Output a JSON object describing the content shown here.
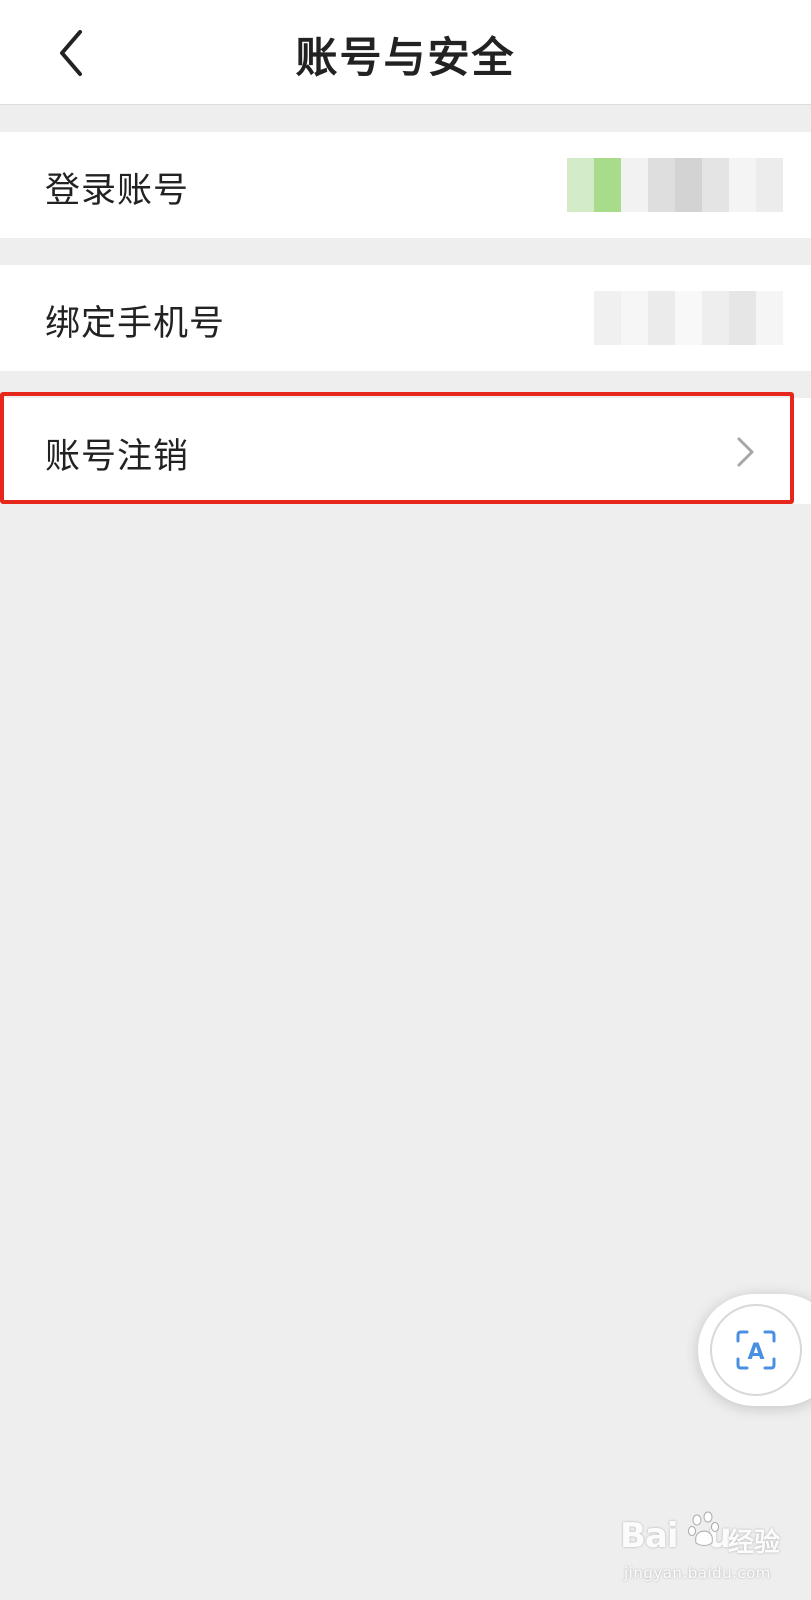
{
  "header": {
    "title": "账号与安全",
    "back_icon": "chevron-left-icon"
  },
  "rows": [
    {
      "label": "登录账号",
      "value": "",
      "value_obscured": true,
      "value_colors": [
        "#d3ecc7",
        "#a9dc8a",
        "#f2f2f2",
        "#dedede",
        "#d3d3d3",
        "#e4e4e4",
        "#f4f4f4",
        "#ececec"
      ]
    },
    {
      "label": "绑定手机号",
      "value": "",
      "value_obscured": true,
      "value_colors": [
        "#f0f0f0",
        "#f6f6f6",
        "#ebebeb",
        "#f8f8f8",
        "#eeeeee",
        "#e6e6e6",
        "#f5f5f5"
      ]
    },
    {
      "label": "账号注销",
      "trailing_icon": "chevron-right-icon"
    }
  ],
  "highlight_color": "#e8271c",
  "float_button": {
    "icon": "text-scan-icon",
    "glyph": "A",
    "accent": "#4a90e2"
  },
  "watermark": {
    "brand": "Bai",
    "brand_end": "u",
    "product": "经验",
    "url": "jingyan.baidu.com"
  }
}
